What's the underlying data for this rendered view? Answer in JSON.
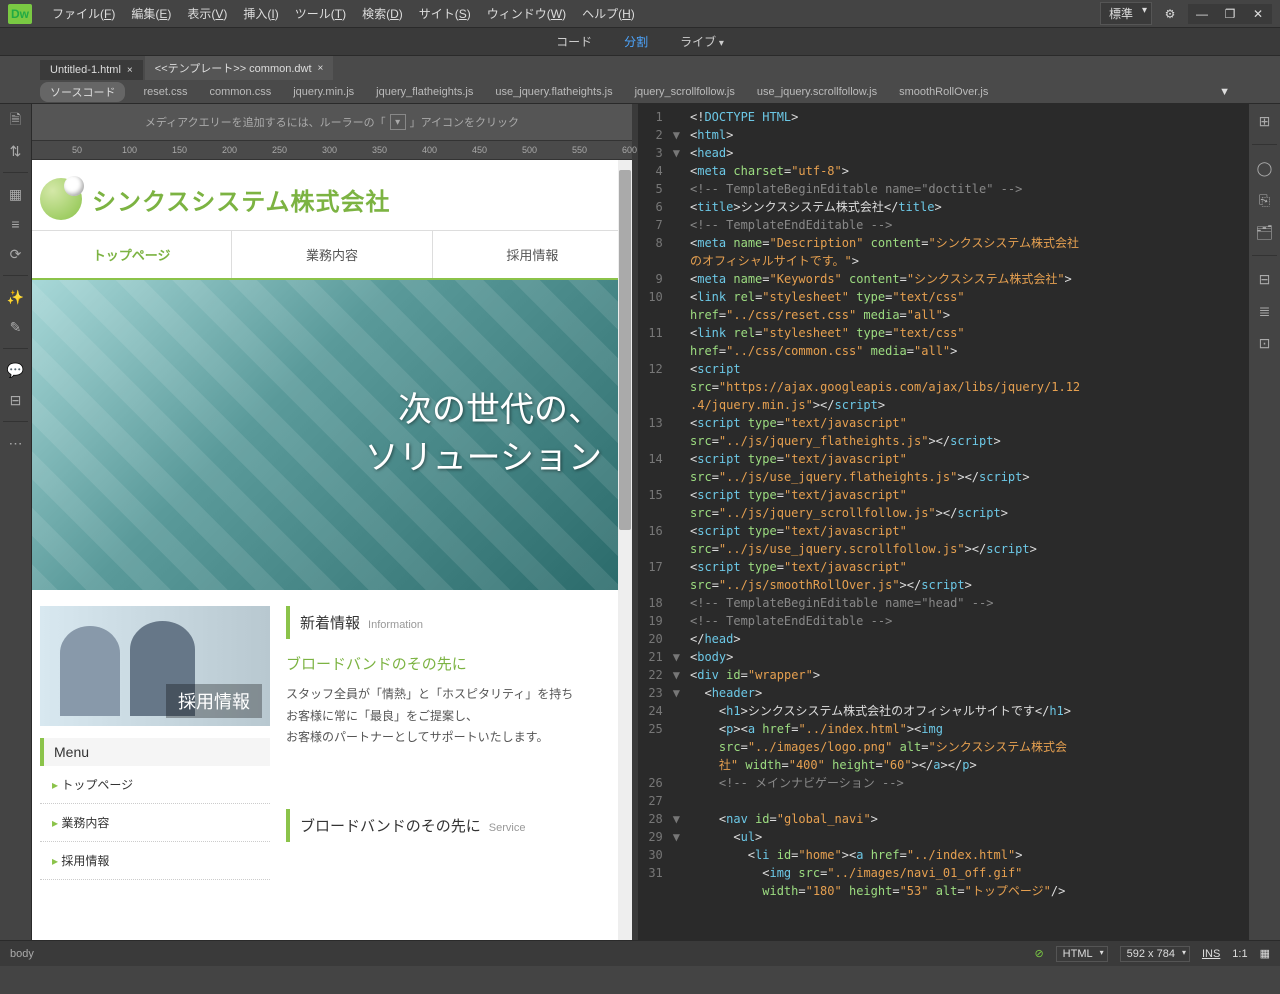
{
  "menubar": {
    "items": [
      "ファイル(F)",
      "編集(E)",
      "表示(V)",
      "挿入(I)",
      "ツール(T)",
      "検索(D)",
      "サイト(S)",
      "ウィンドウ(W)",
      "ヘルプ(H)"
    ],
    "workspace": "標準"
  },
  "viewbar": {
    "code": "コード",
    "split": "分割",
    "live": "ライブ"
  },
  "tabs": [
    {
      "label": "Untitled-1.html",
      "active": false
    },
    {
      "label": "<<テンプレート>> common.dwt",
      "active": true
    }
  ],
  "related": {
    "source": "ソースコード",
    "files": [
      "reset.css",
      "common.css",
      "jquery.min.js",
      "jquery_flatheights.js",
      "use_jquery.flatheights.js",
      "jquery_scrollfollow.js",
      "use_jquery.scrollfollow.js",
      "smoothRollOver.js"
    ]
  },
  "mediaHint": "メディアクエリーを追加するには、ルーラーの「",
  "mediaHint2": "」アイコンをクリック",
  "ruler": [
    "50",
    "100",
    "150",
    "200",
    "250",
    "300",
    "350",
    "400",
    "450",
    "500",
    "550",
    "600"
  ],
  "preview": {
    "companyName": "シンクスシステム株式会社",
    "nav": [
      "トップページ",
      "業務内容",
      "採用情報"
    ],
    "heroLine1": "次の世代の、",
    "heroLine2": "ソリューション",
    "recruitLabel": "採用情報",
    "menuTitle": "Menu",
    "menuItems": [
      "トップページ",
      "業務内容",
      "採用情報"
    ],
    "newsHeader": "新着情報",
    "newsHeaderSub": "Information",
    "newsTitle": "ブロードバンドのその先に",
    "newsBody": "スタッフ全員が「情熱」と「ホスピタリティ」を持ち\nお客様に常に「最良」をご提案し、\nお客様のパートナーとしてサポートいたします。",
    "serviceHeader": "ブロードバンドのその先に",
    "serviceHeaderSub": "Service"
  },
  "code": {
    "lines": [
      {
        "n": 1,
        "fold": "",
        "html": "<span class='p'>&lt;!</span><span class='t'>DOCTYPE HTML</span><span class='p'>&gt;</span>"
      },
      {
        "n": 2,
        "fold": "▼",
        "html": "<span class='p'>&lt;</span><span class='t'>html</span><span class='p'>&gt;</span>"
      },
      {
        "n": 3,
        "fold": "▼",
        "html": "<span class='p'>&lt;</span><span class='t'>head</span><span class='p'>&gt;</span>"
      },
      {
        "n": 4,
        "fold": "",
        "html": "<span class='p'>&lt;</span><span class='t'>meta</span> <span class='a'>charset</span><span class='p'>=</span><span class='s'>\"utf-8\"</span><span class='p'>&gt;</span>"
      },
      {
        "n": 5,
        "fold": "",
        "html": "<span class='c'>&lt;!-- TemplateBeginEditable name=\"doctitle\" --&gt;</span>"
      },
      {
        "n": 6,
        "fold": "",
        "html": "<span class='p'>&lt;</span><span class='t'>title</span><span class='p'>&gt;</span><span class='tx'>シンクスシステム株式会社</span><span class='p'>&lt;/</span><span class='t'>title</span><span class='p'>&gt;</span>"
      },
      {
        "n": 7,
        "fold": "",
        "html": "<span class='c'>&lt;!-- TemplateEndEditable --&gt;</span>"
      },
      {
        "n": 8,
        "fold": "",
        "html": "<span class='p'>&lt;</span><span class='t'>meta</span> <span class='a'>name</span><span class='p'>=</span><span class='s'>\"Description\"</span> <span class='a'>content</span><span class='p'>=</span><span class='s'>\"シンクスシステム株式会社</span>"
      },
      {
        "n": "",
        "fold": "",
        "html": "<span class='s'>のオフィシャルサイトです。\"</span><span class='p'>&gt;</span>"
      },
      {
        "n": 9,
        "fold": "",
        "html": "<span class='p'>&lt;</span><span class='t'>meta</span> <span class='a'>name</span><span class='p'>=</span><span class='s'>\"Keywords\"</span> <span class='a'>content</span><span class='p'>=</span><span class='s'>\"シンクスシステム株式会社\"</span><span class='p'>&gt;</span>"
      },
      {
        "n": 10,
        "fold": "",
        "html": "<span class='p'>&lt;</span><span class='t'>link</span> <span class='a'>rel</span><span class='p'>=</span><span class='s'>\"stylesheet\"</span> <span class='a'>type</span><span class='p'>=</span><span class='s'>\"text/css\"</span>"
      },
      {
        "n": "",
        "fold": "",
        "html": "<span class='a'>href</span><span class='p'>=</span><span class='s'>\"../css/reset.css\"</span> <span class='a'>media</span><span class='p'>=</span><span class='s'>\"all\"</span><span class='p'>&gt;</span>"
      },
      {
        "n": 11,
        "fold": "",
        "html": "<span class='p'>&lt;</span><span class='t'>link</span> <span class='a'>rel</span><span class='p'>=</span><span class='s'>\"stylesheet\"</span> <span class='a'>type</span><span class='p'>=</span><span class='s'>\"text/css\"</span>"
      },
      {
        "n": "",
        "fold": "",
        "html": "<span class='a'>href</span><span class='p'>=</span><span class='s'>\"../css/common.css\"</span> <span class='a'>media</span><span class='p'>=</span><span class='s'>\"all\"</span><span class='p'>&gt;</span>"
      },
      {
        "n": 12,
        "fold": "",
        "html": "<span class='p'>&lt;</span><span class='t'>script</span>"
      },
      {
        "n": "",
        "fold": "",
        "html": "<span class='a'>src</span><span class='p'>=</span><span class='s'>\"https://ajax.googleapis.com/ajax/libs/jquery/1.12</span>"
      },
      {
        "n": "",
        "fold": "",
        "html": "<span class='s'>.4/jquery.min.js\"</span><span class='p'>&gt;&lt;/</span><span class='t'>script</span><span class='p'>&gt;</span>"
      },
      {
        "n": 13,
        "fold": "",
        "html": "<span class='p'>&lt;</span><span class='t'>script</span> <span class='a'>type</span><span class='p'>=</span><span class='s'>\"text/javascript\"</span>"
      },
      {
        "n": "",
        "fold": "",
        "html": "<span class='a'>src</span><span class='p'>=</span><span class='s'>\"../js/jquery_flatheights.js\"</span><span class='p'>&gt;&lt;/</span><span class='t'>script</span><span class='p'>&gt;</span>"
      },
      {
        "n": 14,
        "fold": "",
        "html": "<span class='p'>&lt;</span><span class='t'>script</span> <span class='a'>type</span><span class='p'>=</span><span class='s'>\"text/javascript\"</span>"
      },
      {
        "n": "",
        "fold": "",
        "html": "<span class='a'>src</span><span class='p'>=</span><span class='s'>\"../js/use_jquery.flatheights.js\"</span><span class='p'>&gt;&lt;/</span><span class='t'>script</span><span class='p'>&gt;</span>"
      },
      {
        "n": 15,
        "fold": "",
        "html": "<span class='p'>&lt;</span><span class='t'>script</span> <span class='a'>type</span><span class='p'>=</span><span class='s'>\"text/javascript\"</span>"
      },
      {
        "n": "",
        "fold": "",
        "html": "<span class='a'>src</span><span class='p'>=</span><span class='s'>\"../js/jquery_scrollfollow.js\"</span><span class='p'>&gt;&lt;/</span><span class='t'>script</span><span class='p'>&gt;</span>"
      },
      {
        "n": 16,
        "fold": "",
        "html": "<span class='p'>&lt;</span><span class='t'>script</span> <span class='a'>type</span><span class='p'>=</span><span class='s'>\"text/javascript\"</span>"
      },
      {
        "n": "",
        "fold": "",
        "html": "<span class='a'>src</span><span class='p'>=</span><span class='s'>\"../js/use_jquery.scrollfollow.js\"</span><span class='p'>&gt;&lt;/</span><span class='t'>script</span><span class='p'>&gt;</span>"
      },
      {
        "n": 17,
        "fold": "",
        "html": "<span class='p'>&lt;</span><span class='t'>script</span> <span class='a'>type</span><span class='p'>=</span><span class='s'>\"text/javascript\"</span>"
      },
      {
        "n": "",
        "fold": "",
        "html": "<span class='a'>src</span><span class='p'>=</span><span class='s'>\"../js/smoothRollOver.js\"</span><span class='p'>&gt;&lt;/</span><span class='t'>script</span><span class='p'>&gt;</span>"
      },
      {
        "n": 18,
        "fold": "",
        "html": "<span class='c'>&lt;!-- TemplateBeginEditable name=\"head\" --&gt;</span>"
      },
      {
        "n": 19,
        "fold": "",
        "html": "<span class='c'>&lt;!-- TemplateEndEditable --&gt;</span>"
      },
      {
        "n": 20,
        "fold": "",
        "html": "<span class='p'>&lt;/</span><span class='t'>head</span><span class='p'>&gt;</span>"
      },
      {
        "n": 21,
        "fold": "▼",
        "html": "<span class='p'>&lt;</span><span class='t'>body</span><span class='p'>&gt;</span>"
      },
      {
        "n": 22,
        "fold": "▼",
        "html": "<span class='p'>&lt;</span><span class='t'>div</span> <span class='a'>id</span><span class='p'>=</span><span class='s'>\"wrapper\"</span><span class='p'>&gt;</span>"
      },
      {
        "n": 23,
        "fold": "▼",
        "html": "  <span class='p'>&lt;</span><span class='t'>header</span><span class='p'>&gt;</span>"
      },
      {
        "n": 24,
        "fold": "",
        "html": "    <span class='p'>&lt;</span><span class='t'>h1</span><span class='p'>&gt;</span><span class='tx'>シンクスシステム株式会社のオフィシャルサイトです</span><span class='p'>&lt;/</span><span class='t'>h1</span><span class='p'>&gt;</span>"
      },
      {
        "n": 25,
        "fold": "",
        "html": "    <span class='p'>&lt;</span><span class='t'>p</span><span class='p'>&gt;&lt;</span><span class='t'>a</span> <span class='a'>href</span><span class='p'>=</span><span class='s'>\"../index.html\"</span><span class='p'>&gt;&lt;</span><span class='t'>img</span>"
      },
      {
        "n": "",
        "fold": "",
        "html": "    <span class='a'>src</span><span class='p'>=</span><span class='s'>\"../images/logo.png\"</span> <span class='a'>alt</span><span class='p'>=</span><span class='s'>\"シンクスシステム株式会</span>"
      },
      {
        "n": "",
        "fold": "",
        "html": "    <span class='s'>社\"</span> <span class='a'>width</span><span class='p'>=</span><span class='s'>\"400\"</span> <span class='a'>height</span><span class='p'>=</span><span class='s'>\"60\"</span><span class='p'>&gt;&lt;/</span><span class='t'>a</span><span class='p'>&gt;&lt;/</span><span class='t'>p</span><span class='p'>&gt;</span>"
      },
      {
        "n": 26,
        "fold": "",
        "html": "    <span class='c'>&lt;!-- メインナビゲーション --&gt;</span>"
      },
      {
        "n": 27,
        "fold": "",
        "html": ""
      },
      {
        "n": 28,
        "fold": "▼",
        "html": "    <span class='p'>&lt;</span><span class='t'>nav</span> <span class='a'>id</span><span class='p'>=</span><span class='s'>\"global_navi\"</span><span class='p'>&gt;</span>"
      },
      {
        "n": 29,
        "fold": "▼",
        "html": "      <span class='p'>&lt;</span><span class='t'>ul</span><span class='p'>&gt;</span>"
      },
      {
        "n": 30,
        "fold": "",
        "html": "        <span class='p'>&lt;</span><span class='t'>li</span> <span class='a'>id</span><span class='p'>=</span><span class='s'>\"home\"</span><span class='p'>&gt;&lt;</span><span class='t'>a</span> <span class='a'>href</span><span class='p'>=</span><span class='s'>\"../index.html\"</span><span class='p'>&gt;</span>"
      },
      {
        "n": 31,
        "fold": "",
        "html": "          <span class='p'>&lt;</span><span class='t'>img</span> <span class='a'>src</span><span class='p'>=</span><span class='s'>\"../images/navi_01_off.gif\"</span>"
      },
      {
        "n": "",
        "fold": "",
        "html": "          <span class='a'>width</span><span class='p'>=</span><span class='s'>\"180\"</span> <span class='a'>height</span><span class='p'>=</span><span class='s'>\"53\"</span> <span class='a'>alt</span><span class='p'>=</span><span class='s'>\"トップページ\"</span><span class='p'>/&gt;</span>"
      }
    ]
  },
  "status": {
    "path": "body",
    "lang": "HTML",
    "size": "592 x 784",
    "ins": "INS",
    "pos": "1:1"
  }
}
